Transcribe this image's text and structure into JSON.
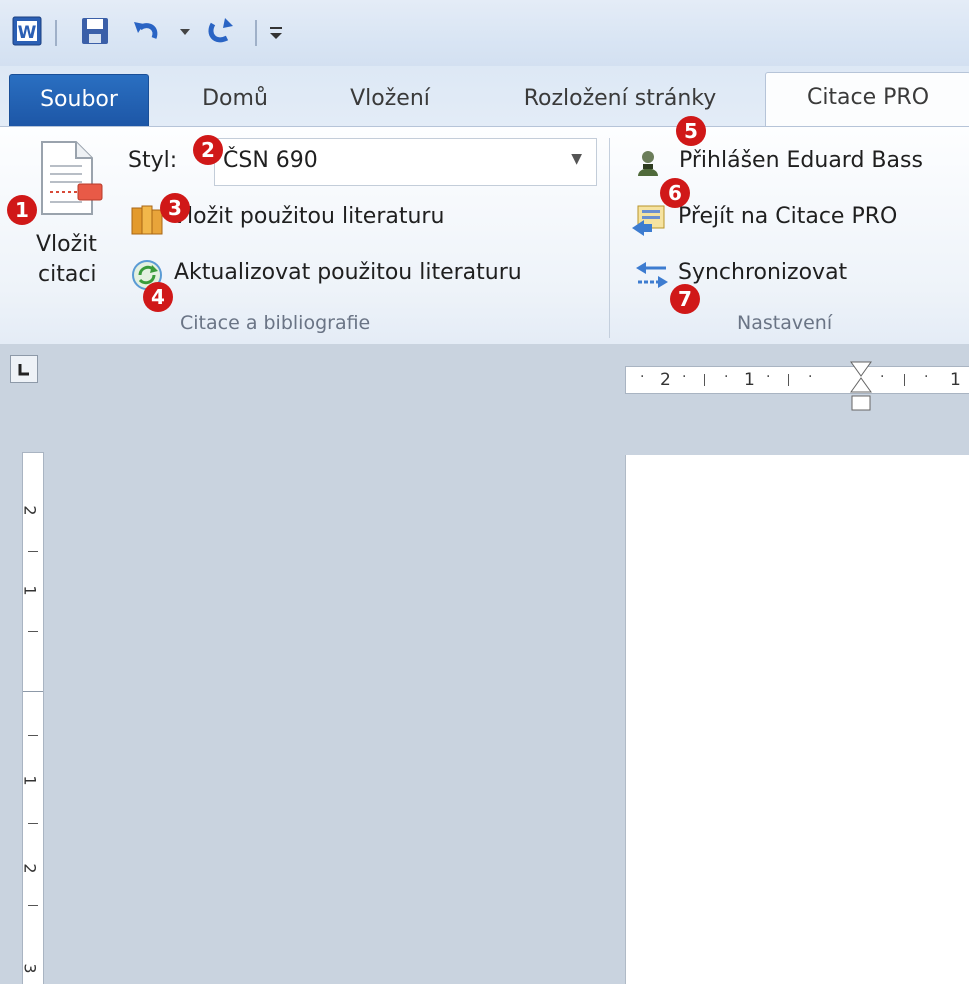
{
  "quick_access": {
    "app_icon": "word-icon",
    "save_icon": "save-icon",
    "undo_icon": "undo-icon",
    "dropdown_icon": "chevron-down-icon",
    "redo_icon": "redo-icon",
    "customize_icon": "customize-toolbar-icon"
  },
  "tabs": [
    {
      "label": "Soubor"
    },
    {
      "label": "Domů"
    },
    {
      "label": "Vložení"
    },
    {
      "label": "Rozložení stránky"
    },
    {
      "label": "Citace PRO"
    }
  ],
  "ribbon": {
    "insert_citation": {
      "line1": "Vložit",
      "line2": "citaci"
    },
    "style": {
      "label": "Styl:",
      "value": "ČSN 690"
    },
    "insert_bibliography": "Vložit použitou literaturu",
    "update_bibliography": "Aktualizovat použitou literaturu",
    "group_citations": "Citace a bibliografie",
    "logged_in": "Přihlášen Eduard Bass",
    "go_to": "Přejít na Citace PRO",
    "sync": "Synchronizovat",
    "group_settings": "Nastavení"
  },
  "badges": [
    "1",
    "2",
    "3",
    "4",
    "5",
    "6",
    "7"
  ],
  "ruler": {
    "horizontal": [
      "2",
      "1",
      "1"
    ],
    "vertical": [
      "2",
      "1",
      "1",
      "2",
      "3"
    ]
  },
  "colors": {
    "file_tab": "#1d56a6",
    "badge": "#d01818",
    "workspace": "#c9d3df"
  }
}
